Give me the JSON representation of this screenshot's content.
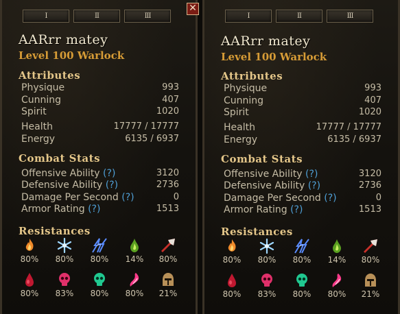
{
  "panels": [
    {
      "tabs": [
        "I",
        "II",
        "III"
      ],
      "character_name": "AARrr matey",
      "character_level": "Level 100 Warlock",
      "sections": {
        "attributes": "Attributes",
        "combat": "Combat Stats",
        "resistances": "Resistances"
      },
      "attributes": [
        {
          "label": "Physique",
          "value": "993"
        },
        {
          "label": "Cunning",
          "value": "407"
        },
        {
          "label": "Spirit",
          "value": "1020"
        },
        {
          "label": "Health",
          "value": "17777 / 17777"
        },
        {
          "label": "Energy",
          "value": "6135 / 6937"
        }
      ],
      "combat": [
        {
          "label": "Offensive Ability",
          "help": "(?)",
          "value": "3120"
        },
        {
          "label": "Defensive Ability",
          "help": "(?)",
          "value": "2736"
        },
        {
          "label": "Damage Per Second",
          "help": "(?)",
          "value": "0"
        },
        {
          "label": "Armor Rating",
          "help": "(?)",
          "value": "1513"
        }
      ],
      "resistances": [
        {
          "icon": "fire-icon",
          "value": "80%",
          "color": "#f08a2a"
        },
        {
          "icon": "cold-icon",
          "value": "80%",
          "color": "#9fd8ff"
        },
        {
          "icon": "lightning-icon",
          "value": "80%",
          "color": "#5a8cff"
        },
        {
          "icon": "poison-icon",
          "value": "14%",
          "color": "#8fd12a"
        },
        {
          "icon": "pierce-icon",
          "value": "80%",
          "color": "#c8302a"
        },
        {
          "icon": "bleeding-icon",
          "value": "80%",
          "color": "#c01830"
        },
        {
          "icon": "vitality-icon",
          "value": "83%",
          "color": "#e0306a"
        },
        {
          "icon": "aether-icon",
          "value": "80%",
          "color": "#2ae0a0"
        },
        {
          "icon": "chaos-icon",
          "value": "80%",
          "color": "#ff3a8a"
        },
        {
          "icon": "stun-icon",
          "value": "21%",
          "color": "#d8b070"
        }
      ]
    },
    {
      "tabs": [
        "I",
        "II",
        "III"
      ],
      "character_name": "AARrr matey",
      "character_level": "Level 100 Warlock",
      "sections": {
        "attributes": "Attributes",
        "combat": "Combat Stats",
        "resistances": "Resistances"
      },
      "attributes": [
        {
          "label": "Physique",
          "value": "993"
        },
        {
          "label": "Cunning",
          "value": "407"
        },
        {
          "label": "Spirit",
          "value": "1020"
        },
        {
          "label": "Health",
          "value": "17777 / 17777"
        },
        {
          "label": "Energy",
          "value": "6135 / 6937"
        }
      ],
      "combat": [
        {
          "label": "Offensive Ability",
          "help": "(?)",
          "value": "3120"
        },
        {
          "label": "Defensive Ability",
          "help": "(?)",
          "value": "2736"
        },
        {
          "label": "Damage Per Second",
          "help": "(?)",
          "value": "0"
        },
        {
          "label": "Armor Rating",
          "help": "(?)",
          "value": "1513"
        }
      ],
      "resistances": [
        {
          "icon": "fire-icon",
          "value": "80%",
          "color": "#f08a2a"
        },
        {
          "icon": "cold-icon",
          "value": "80%",
          "color": "#9fd8ff"
        },
        {
          "icon": "lightning-icon",
          "value": "80%",
          "color": "#5a8cff"
        },
        {
          "icon": "poison-icon",
          "value": "14%",
          "color": "#8fd12a"
        },
        {
          "icon": "pierce-icon",
          "value": "80%",
          "color": "#c8302a"
        },
        {
          "icon": "bleeding-icon",
          "value": "80%",
          "color": "#c01830"
        },
        {
          "icon": "vitality-icon",
          "value": "83%",
          "color": "#e0306a"
        },
        {
          "icon": "aether-icon",
          "value": "80%",
          "color": "#2ae0a0"
        },
        {
          "icon": "chaos-icon",
          "value": "80%",
          "color": "#ff3a8a"
        },
        {
          "icon": "stun-icon",
          "value": "21%",
          "color": "#d8b070"
        }
      ],
      "close_icon": "close-icon"
    }
  ]
}
